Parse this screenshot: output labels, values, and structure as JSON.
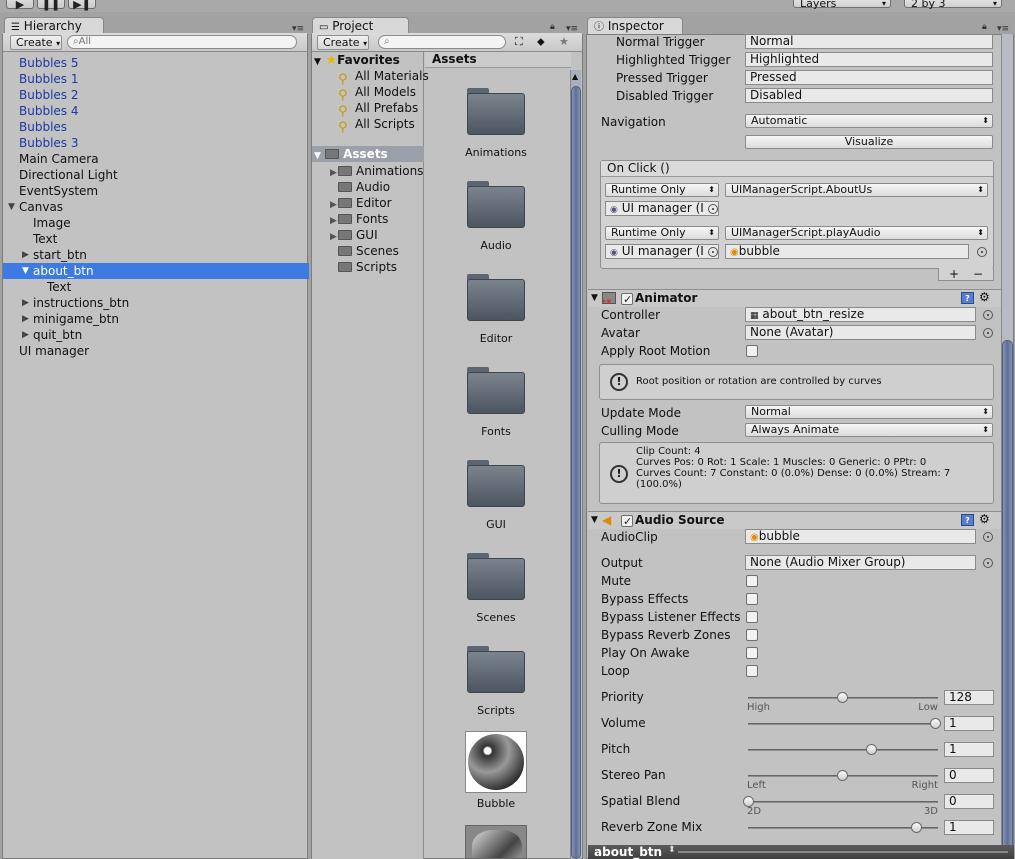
{
  "topbar": {
    "play_icon": "play-icon",
    "pause_icon": "pause-icon",
    "step_icon": "step-icon",
    "layers_label": "Layers",
    "layout_label": "2 by 3"
  },
  "hierarchy": {
    "tab_label": "Hierarchy",
    "create_label": "Create",
    "search_placeholder": "All",
    "items": [
      {
        "label": "Bubbles 5"
      },
      {
        "label": "Bubbles 1"
      },
      {
        "label": "Bubbles 2"
      },
      {
        "label": "Bubbles 4"
      },
      {
        "label": "Bubbles"
      },
      {
        "label": "Bubbles 3"
      },
      {
        "label": "Main Camera"
      },
      {
        "label": "Directional Light"
      },
      {
        "label": "EventSystem"
      },
      {
        "label": "Canvas"
      },
      {
        "label": "Image"
      },
      {
        "label": "Text"
      },
      {
        "label": "start_btn"
      },
      {
        "label": "about_btn"
      },
      {
        "label": "Text"
      },
      {
        "label": "instructions_btn"
      },
      {
        "label": "minigame_btn"
      },
      {
        "label": "quit_btn"
      },
      {
        "label": "UI manager"
      }
    ]
  },
  "project": {
    "tab_label": "Project",
    "create_label": "Create",
    "favorites_label": "Favorites",
    "favorites": [
      "All Materials",
      "All Models",
      "All Prefabs",
      "All Scripts"
    ],
    "assets_label": "Assets",
    "folders": [
      "Animations",
      "Audio",
      "Editor",
      "Fonts",
      "GUI",
      "Scenes",
      "Scripts"
    ],
    "assets_header": "Assets",
    "asset_items": [
      "Animations",
      "Audio",
      "Editor",
      "Fonts",
      "GUI",
      "Scenes",
      "Scripts",
      "Bubble"
    ]
  },
  "inspector": {
    "tab_label": "Inspector",
    "triggers": [
      {
        "label": "Normal Trigger",
        "value": "Normal"
      },
      {
        "label": "Highlighted Trigger",
        "value": "Highlighted"
      },
      {
        "label": "Pressed Trigger",
        "value": "Pressed"
      },
      {
        "label": "Disabled Trigger",
        "value": "Disabled"
      }
    ],
    "navigation_label": "Navigation",
    "navigation_value": "Automatic",
    "visualize_label": "Visualize",
    "onclick_label": "On Click ()",
    "onclick_entries": [
      {
        "mode": "Runtime Only",
        "function": "UIManagerScript.AboutUs",
        "target": "UI manager (I",
        "arg": ""
      },
      {
        "mode": "Runtime Only",
        "function": "UIManagerScript.playAudio",
        "target": "UI manager (I",
        "arg": "bubble"
      }
    ],
    "plus_label": "+",
    "minus_label": "−",
    "animator": {
      "title": "Animator",
      "controller_label": "Controller",
      "controller_value": "about_btn_resize",
      "avatar_label": "Avatar",
      "avatar_value": "None (Avatar)",
      "root_motion_label": "Apply Root Motion",
      "help_text": "Root position or rotation are controlled by curves",
      "update_mode_label": "Update Mode",
      "update_mode_value": "Normal",
      "culling_mode_label": "Culling Mode",
      "culling_mode_value": "Always Animate",
      "info_line1": "Clip Count: 4",
      "info_line2": "Curves Pos: 0 Rot: 1 Scale: 1 Muscles: 0 Generic: 0 PPtr: 0",
      "info_line3": "Curves Count: 7 Constant: 0 (0.0%) Dense: 0 (0.0%) Stream: 7",
      "info_line4": "(100.0%)"
    },
    "audio": {
      "title": "Audio Source",
      "clip_label": "AudioClip",
      "clip_value": "bubble",
      "output_label": "Output",
      "output_value": "None (Audio Mixer Group)",
      "toggles": [
        {
          "label": "Mute"
        },
        {
          "label": "Bypass Effects"
        },
        {
          "label": "Bypass Listener Effects"
        },
        {
          "label": "Bypass Reverb Zones"
        },
        {
          "label": "Play On Awake"
        },
        {
          "label": "Loop"
        }
      ],
      "sliders": [
        {
          "label": "Priority",
          "value": "128",
          "fraction": 0.5,
          "min_label": "High",
          "max_label": "Low"
        },
        {
          "label": "Volume",
          "value": "1",
          "fraction": 1.0,
          "min_label": "",
          "max_label": ""
        },
        {
          "label": "Pitch",
          "value": "1",
          "fraction": 0.66,
          "min_label": "",
          "max_label": ""
        },
        {
          "label": "Stereo Pan",
          "value": "0",
          "fraction": 0.5,
          "min_label": "Left",
          "max_label": "Right"
        },
        {
          "label": "Spatial Blend",
          "value": "0",
          "fraction": 0.0,
          "min_label": "2D",
          "max_label": "3D"
        },
        {
          "label": "Reverb Zone Mix",
          "value": "1",
          "fraction": 0.9,
          "min_label": "",
          "max_label": ""
        }
      ]
    },
    "bottom_label": "about_btn"
  },
  "colors": {
    "selection": "#3d7be3",
    "prefab_text": "#1b39a8",
    "scroll_thumb": "#5e6f95"
  }
}
